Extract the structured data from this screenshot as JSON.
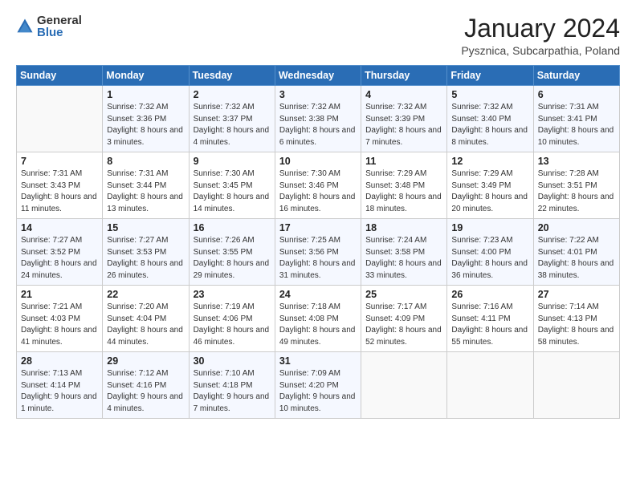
{
  "logo": {
    "general": "General",
    "blue": "Blue"
  },
  "header": {
    "month": "January 2024",
    "location": "Pysznica, Subcarpathia, Poland"
  },
  "weekdays": [
    "Sunday",
    "Monday",
    "Tuesday",
    "Wednesday",
    "Thursday",
    "Friday",
    "Saturday"
  ],
  "weeks": [
    [
      {
        "day": "",
        "sunrise": "",
        "sunset": "",
        "daylight": ""
      },
      {
        "day": "1",
        "sunrise": "Sunrise: 7:32 AM",
        "sunset": "Sunset: 3:36 PM",
        "daylight": "Daylight: 8 hours and 3 minutes."
      },
      {
        "day": "2",
        "sunrise": "Sunrise: 7:32 AM",
        "sunset": "Sunset: 3:37 PM",
        "daylight": "Daylight: 8 hours and 4 minutes."
      },
      {
        "day": "3",
        "sunrise": "Sunrise: 7:32 AM",
        "sunset": "Sunset: 3:38 PM",
        "daylight": "Daylight: 8 hours and 6 minutes."
      },
      {
        "day": "4",
        "sunrise": "Sunrise: 7:32 AM",
        "sunset": "Sunset: 3:39 PM",
        "daylight": "Daylight: 8 hours and 7 minutes."
      },
      {
        "day": "5",
        "sunrise": "Sunrise: 7:32 AM",
        "sunset": "Sunset: 3:40 PM",
        "daylight": "Daylight: 8 hours and 8 minutes."
      },
      {
        "day": "6",
        "sunrise": "Sunrise: 7:31 AM",
        "sunset": "Sunset: 3:41 PM",
        "daylight": "Daylight: 8 hours and 10 minutes."
      }
    ],
    [
      {
        "day": "7",
        "sunrise": "Sunrise: 7:31 AM",
        "sunset": "Sunset: 3:43 PM",
        "daylight": "Daylight: 8 hours and 11 minutes."
      },
      {
        "day": "8",
        "sunrise": "Sunrise: 7:31 AM",
        "sunset": "Sunset: 3:44 PM",
        "daylight": "Daylight: 8 hours and 13 minutes."
      },
      {
        "day": "9",
        "sunrise": "Sunrise: 7:30 AM",
        "sunset": "Sunset: 3:45 PM",
        "daylight": "Daylight: 8 hours and 14 minutes."
      },
      {
        "day": "10",
        "sunrise": "Sunrise: 7:30 AM",
        "sunset": "Sunset: 3:46 PM",
        "daylight": "Daylight: 8 hours and 16 minutes."
      },
      {
        "day": "11",
        "sunrise": "Sunrise: 7:29 AM",
        "sunset": "Sunset: 3:48 PM",
        "daylight": "Daylight: 8 hours and 18 minutes."
      },
      {
        "day": "12",
        "sunrise": "Sunrise: 7:29 AM",
        "sunset": "Sunset: 3:49 PM",
        "daylight": "Daylight: 8 hours and 20 minutes."
      },
      {
        "day": "13",
        "sunrise": "Sunrise: 7:28 AM",
        "sunset": "Sunset: 3:51 PM",
        "daylight": "Daylight: 8 hours and 22 minutes."
      }
    ],
    [
      {
        "day": "14",
        "sunrise": "Sunrise: 7:27 AM",
        "sunset": "Sunset: 3:52 PM",
        "daylight": "Daylight: 8 hours and 24 minutes."
      },
      {
        "day": "15",
        "sunrise": "Sunrise: 7:27 AM",
        "sunset": "Sunset: 3:53 PM",
        "daylight": "Daylight: 8 hours and 26 minutes."
      },
      {
        "day": "16",
        "sunrise": "Sunrise: 7:26 AM",
        "sunset": "Sunset: 3:55 PM",
        "daylight": "Daylight: 8 hours and 29 minutes."
      },
      {
        "day": "17",
        "sunrise": "Sunrise: 7:25 AM",
        "sunset": "Sunset: 3:56 PM",
        "daylight": "Daylight: 8 hours and 31 minutes."
      },
      {
        "day": "18",
        "sunrise": "Sunrise: 7:24 AM",
        "sunset": "Sunset: 3:58 PM",
        "daylight": "Daylight: 8 hours and 33 minutes."
      },
      {
        "day": "19",
        "sunrise": "Sunrise: 7:23 AM",
        "sunset": "Sunset: 4:00 PM",
        "daylight": "Daylight: 8 hours and 36 minutes."
      },
      {
        "day": "20",
        "sunrise": "Sunrise: 7:22 AM",
        "sunset": "Sunset: 4:01 PM",
        "daylight": "Daylight: 8 hours and 38 minutes."
      }
    ],
    [
      {
        "day": "21",
        "sunrise": "Sunrise: 7:21 AM",
        "sunset": "Sunset: 4:03 PM",
        "daylight": "Daylight: 8 hours and 41 minutes."
      },
      {
        "day": "22",
        "sunrise": "Sunrise: 7:20 AM",
        "sunset": "Sunset: 4:04 PM",
        "daylight": "Daylight: 8 hours and 44 minutes."
      },
      {
        "day": "23",
        "sunrise": "Sunrise: 7:19 AM",
        "sunset": "Sunset: 4:06 PM",
        "daylight": "Daylight: 8 hours and 46 minutes."
      },
      {
        "day": "24",
        "sunrise": "Sunrise: 7:18 AM",
        "sunset": "Sunset: 4:08 PM",
        "daylight": "Daylight: 8 hours and 49 minutes."
      },
      {
        "day": "25",
        "sunrise": "Sunrise: 7:17 AM",
        "sunset": "Sunset: 4:09 PM",
        "daylight": "Daylight: 8 hours and 52 minutes."
      },
      {
        "day": "26",
        "sunrise": "Sunrise: 7:16 AM",
        "sunset": "Sunset: 4:11 PM",
        "daylight": "Daylight: 8 hours and 55 minutes."
      },
      {
        "day": "27",
        "sunrise": "Sunrise: 7:14 AM",
        "sunset": "Sunset: 4:13 PM",
        "daylight": "Daylight: 8 hours and 58 minutes."
      }
    ],
    [
      {
        "day": "28",
        "sunrise": "Sunrise: 7:13 AM",
        "sunset": "Sunset: 4:14 PM",
        "daylight": "Daylight: 9 hours and 1 minute."
      },
      {
        "day": "29",
        "sunrise": "Sunrise: 7:12 AM",
        "sunset": "Sunset: 4:16 PM",
        "daylight": "Daylight: 9 hours and 4 minutes."
      },
      {
        "day": "30",
        "sunrise": "Sunrise: 7:10 AM",
        "sunset": "Sunset: 4:18 PM",
        "daylight": "Daylight: 9 hours and 7 minutes."
      },
      {
        "day": "31",
        "sunrise": "Sunrise: 7:09 AM",
        "sunset": "Sunset: 4:20 PM",
        "daylight": "Daylight: 9 hours and 10 minutes."
      },
      {
        "day": "",
        "sunrise": "",
        "sunset": "",
        "daylight": ""
      },
      {
        "day": "",
        "sunrise": "",
        "sunset": "",
        "daylight": ""
      },
      {
        "day": "",
        "sunrise": "",
        "sunset": "",
        "daylight": ""
      }
    ]
  ]
}
